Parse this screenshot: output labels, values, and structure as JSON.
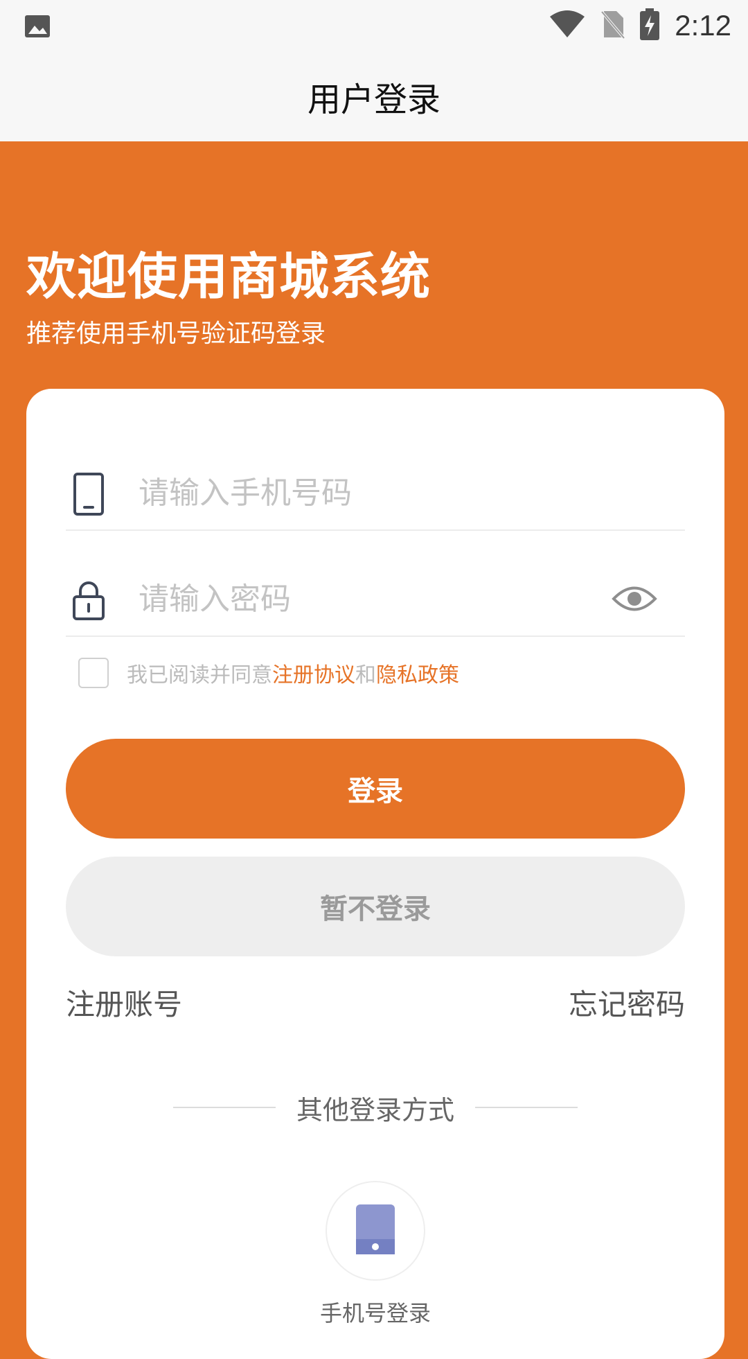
{
  "status_bar": {
    "time": "2:12",
    "icons": [
      "image-icon",
      "wifi-icon",
      "no-sim-icon",
      "battery-charging-icon"
    ]
  },
  "app_bar": {
    "title": "用户登录"
  },
  "hero": {
    "title": "欢迎使用商城系统",
    "subtitle": "推荐使用手机号验证码登录"
  },
  "form": {
    "phone": {
      "placeholder": "请输入手机号码",
      "value": "",
      "icon": "phone-icon"
    },
    "password": {
      "placeholder": "请输入密码",
      "value": "",
      "icon": "lock-icon",
      "toggle_icon": "eye-icon"
    },
    "agreement": {
      "checked": false,
      "prefix": "我已阅读并同意",
      "link1": "注册协议",
      "and": "和",
      "link2": "隐私政策"
    },
    "login_button": "登录",
    "skip_button": "暂不登录",
    "register_link": "注册账号",
    "forgot_link": "忘记密码"
  },
  "other_login": {
    "heading": "其他登录方式",
    "options": [
      {
        "label": "手机号登录",
        "icon": "mobile-icon"
      }
    ]
  },
  "colors": {
    "brand": "#e67327",
    "skip_bg": "#eeeeee",
    "placeholder": "#c3c3c3"
  }
}
